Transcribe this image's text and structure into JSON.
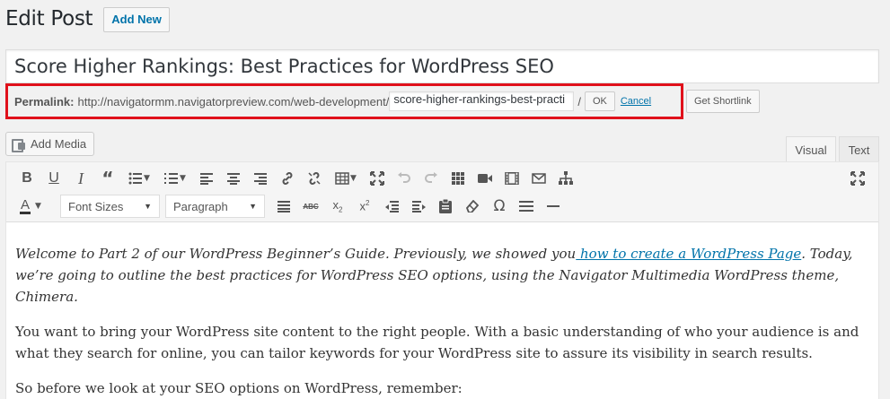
{
  "header": {
    "title": "Edit Post",
    "add_new_label": "Add New"
  },
  "post": {
    "title": "Score Higher Rankings: Best Practices for WordPress SEO"
  },
  "permalink": {
    "label": "Permalink:",
    "base_url": "http://navigatormm.navigatorpreview.com/web-development/",
    "slug": "score-higher-rankings-best-practi",
    "slash": "/",
    "ok_label": "OK",
    "cancel_label": "Cancel",
    "shortlink_label": "Get Shortlink",
    "highlight_color": "#e0111b"
  },
  "media": {
    "add_media_label": "Add Media"
  },
  "tabs": [
    {
      "label": "Visual",
      "active": true
    },
    {
      "label": "Text",
      "active": false
    }
  ],
  "toolbar": {
    "row1": [
      {
        "name": "bold-icon",
        "glyph": "B"
      },
      {
        "name": "italic-icon",
        "glyph": "I"
      },
      {
        "name": "blockquote-icon",
        "glyph": "❝"
      },
      {
        "name": "bullet-list-icon"
      },
      {
        "name": "numbered-list-icon"
      },
      {
        "name": "align-left-icon"
      },
      {
        "name": "align-center-icon"
      },
      {
        "name": "align-right-icon"
      },
      {
        "name": "link-icon"
      },
      {
        "name": "unlink-icon"
      },
      {
        "name": "table-icon"
      },
      {
        "name": "resize-icon"
      },
      {
        "name": "undo-icon"
      },
      {
        "name": "redo-icon"
      },
      {
        "name": "grid-icon"
      },
      {
        "name": "video-icon"
      },
      {
        "name": "film-icon"
      },
      {
        "name": "email-icon"
      },
      {
        "name": "sitemap-icon"
      },
      {
        "name": "fullscreen-icon"
      }
    ],
    "font_size_label": "Font Sizes",
    "format_label": "Paragraph"
  },
  "content": {
    "intro_before_link": "Welcome to Part 2 of our WordPress Beginner’s Guide. Previously, we showed you",
    "intro_link": " how to create a WordPress Page",
    "intro_after_link": ". Today, we’re going to outline the best practices for WordPress SEO options, using the Navigator Multimedia WordPress theme, Chimera.",
    "para2": "You want to bring your WordPress site content to the right people. With a basic understanding of who your audience is and what they search for online, you can tailor keywords for your WordPress site to assure its visibility in search results.",
    "para3": "So before we look at your SEO options on WordPress, remember:"
  }
}
